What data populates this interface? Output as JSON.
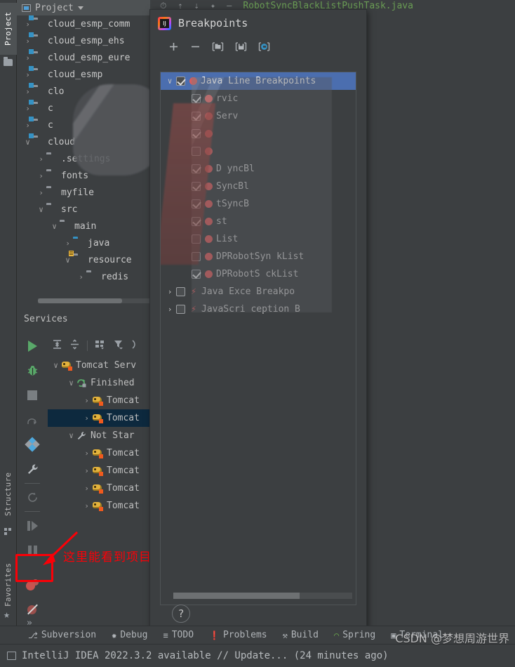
{
  "window": {
    "editor_tab": "RobotSyncBlackListPushTask.java"
  },
  "left_tool_tabs": [
    {
      "label": "Project",
      "icon": "folder-icon",
      "active": true
    },
    {
      "label": "Structure",
      "icon": "structure-icon",
      "active": false
    },
    {
      "label": "Favorites",
      "icon": "star-icon",
      "active": false
    }
  ],
  "project_panel": {
    "title": "Project",
    "icon": "project-icon",
    "dropdown_icon": "chevron-down-icon",
    "tree": [
      {
        "label": "cloud_esmp_comm",
        "indent": 0,
        "arrow": "›",
        "icon": "module-folder",
        "expanded": false
      },
      {
        "label": "cloud_esmp_ehs",
        "indent": 0,
        "arrow": "›",
        "icon": "module-folder",
        "expanded": false
      },
      {
        "label": "cloud_esmp_eure",
        "indent": 0,
        "arrow": "›",
        "icon": "module-folder",
        "expanded": false
      },
      {
        "label": "cloud_esmp",
        "indent": 0,
        "arrow": "›",
        "icon": "module-folder",
        "expanded": false
      },
      {
        "label": "clo",
        "indent": 0,
        "arrow": "›",
        "icon": "module-folder",
        "expanded": false
      },
      {
        "label": "c",
        "indent": 0,
        "arrow": "›",
        "icon": "module-folder",
        "expanded": false
      },
      {
        "label": "c",
        "indent": 0,
        "arrow": "›",
        "icon": "module-folder",
        "expanded": false
      },
      {
        "label": "cloud",
        "indent": 0,
        "arrow": "∨",
        "icon": "module-folder",
        "expanded": true
      },
      {
        "label": ".settings",
        "indent": 1,
        "arrow": "›",
        "icon": "plain-folder",
        "expanded": false
      },
      {
        "label": "fonts",
        "indent": 1,
        "arrow": "›",
        "icon": "plain-folder",
        "expanded": false
      },
      {
        "label": "myfile",
        "indent": 1,
        "arrow": "›",
        "icon": "plain-folder",
        "expanded": false
      },
      {
        "label": "src",
        "indent": 1,
        "arrow": "∨",
        "icon": "plain-folder",
        "expanded": true
      },
      {
        "label": "main",
        "indent": 2,
        "arrow": "∨",
        "icon": "plain-folder",
        "expanded": true
      },
      {
        "label": "java",
        "indent": 3,
        "arrow": "›",
        "icon": "source-folder",
        "expanded": false
      },
      {
        "label": "resource",
        "indent": 3,
        "arrow": "∨",
        "icon": "resource-folder",
        "expanded": true
      },
      {
        "label": "redis",
        "indent": 4,
        "arrow": "›",
        "icon": "plain-folder",
        "expanded": false
      }
    ]
  },
  "services_panel": {
    "title": "Services",
    "run_toolbar": [
      {
        "name": "run-button",
        "icon": "play-icon"
      },
      {
        "name": "debug-button",
        "icon": "bug-icon"
      },
      {
        "name": "stop-button",
        "icon": "stop-icon"
      },
      {
        "name": "step-over-button",
        "icon": "step-over-icon"
      },
      {
        "name": "layers-button",
        "icon": "diamond-icon"
      },
      {
        "name": "settings-button",
        "icon": "wrench-icon"
      },
      {
        "name": "rerun-button",
        "icon": "refresh-icon"
      },
      {
        "name": "step-into-button",
        "icon": "step-into-icon"
      },
      {
        "name": "pause-button",
        "icon": "pause-icon"
      },
      {
        "name": "view-breakpoints-button",
        "icon": "breakpoints-icon"
      },
      {
        "name": "mute-breakpoints-button",
        "icon": "mute-breakpoints-icon"
      }
    ],
    "view_toolbar": [
      {
        "name": "expand-all-button",
        "icon": "expand-all-icon"
      },
      {
        "name": "collapse-all-button",
        "icon": "collapse-all-icon"
      },
      {
        "name": "group-by-button",
        "icon": "group-by-icon"
      },
      {
        "name": "filter-button",
        "icon": "filter-icon"
      },
      {
        "name": "more-button",
        "icon": "more-icon"
      }
    ],
    "tree": [
      {
        "label": "Tomcat Serv",
        "indent": 0,
        "arrow": "∨",
        "icon": "tomcat-icon",
        "selected": false
      },
      {
        "label": "Finished",
        "indent": 1,
        "arrow": "∨",
        "icon": "finished-icon",
        "selected": false
      },
      {
        "label": "Tomcat",
        "indent": 2,
        "arrow": "›",
        "icon": "tomcat-icon",
        "selected": false
      },
      {
        "label": "Tomcat",
        "indent": 2,
        "arrow": "›",
        "icon": "tomcat-icon",
        "selected": true
      },
      {
        "label": "Not Star",
        "indent": 1,
        "arrow": "∨",
        "icon": "wrench-icon",
        "selected": false
      },
      {
        "label": "Tomcat",
        "indent": 2,
        "arrow": "›",
        "icon": "tomcat-icon",
        "selected": false
      },
      {
        "label": "Tomcat",
        "indent": 2,
        "arrow": "›",
        "icon": "tomcat-icon",
        "selected": false
      },
      {
        "label": "Tomcat",
        "indent": 2,
        "arrow": "›",
        "icon": "tomcat-icon",
        "selected": false
      },
      {
        "label": "Tomcat",
        "indent": 2,
        "arrow": "›",
        "icon": "tomcat-icon",
        "selected": false
      }
    ]
  },
  "annotation": {
    "text": "这里能看到项目中断点",
    "color": "#fb0007",
    "arrow_icon": "red-arrow-icon",
    "rect_target": "view-breakpoints-button"
  },
  "breakpoints_dialog": {
    "title": "Breakpoints",
    "app_icon": "intellij-idea-icon",
    "toolbar": [
      {
        "name": "add-breakpoint-button",
        "icon": "plus-icon",
        "glyph": "＋"
      },
      {
        "name": "remove-breakpoint-button",
        "icon": "minus-icon",
        "glyph": "−"
      },
      {
        "name": "open-group-button",
        "icon": "folder-icon",
        "glyph": "⬚"
      },
      {
        "name": "save-group-button",
        "icon": "save-icon",
        "glyph": "⬚"
      },
      {
        "name": "groups-button",
        "icon": "circle-c-icon",
        "glyph": "Ⓒ"
      }
    ],
    "rows": [
      {
        "label": "Java Line Breakpoints",
        "indent": 0,
        "arrow": "∨",
        "checkbox": "checked",
        "marker": "breakpoint-dot",
        "selected": true,
        "obscured": false
      },
      {
        "label": "rvic",
        "indent": 1,
        "arrow": "",
        "checkbox": "checked",
        "marker": "breakpoint-dot",
        "selected": false,
        "obscured": true
      },
      {
        "label": "Serv",
        "indent": 1,
        "arrow": "",
        "checkbox": "checked",
        "marker": "breakpoint-dot",
        "selected": false,
        "obscured": true
      },
      {
        "label": "",
        "indent": 1,
        "arrow": "",
        "checkbox": "checked",
        "marker": "breakpoint-dot",
        "selected": false,
        "obscured": true
      },
      {
        "label": "",
        "indent": 1,
        "arrow": "",
        "checkbox": "unchecked",
        "marker": "breakpoint-dot",
        "selected": false,
        "obscured": true
      },
      {
        "label": "D      yncBl",
        "indent": 1,
        "arrow": "",
        "checkbox": "checked",
        "marker": "breakpoint-dot",
        "selected": false,
        "obscured": true
      },
      {
        "label": "SyncBl",
        "indent": 1,
        "arrow": "",
        "checkbox": "checked",
        "marker": "breakpoint-dot",
        "selected": false,
        "obscured": true
      },
      {
        "label": "tSyncB",
        "indent": 1,
        "arrow": "",
        "checkbox": "checked",
        "marker": "breakpoint-dot",
        "selected": false,
        "obscured": true
      },
      {
        "label": "st",
        "indent": 1,
        "arrow": "",
        "checkbox": "checked",
        "marker": "breakpoint-dot",
        "selected": false,
        "obscured": true
      },
      {
        "label": "List",
        "indent": 1,
        "arrow": "",
        "checkbox": "unchecked",
        "marker": "breakpoint-dot",
        "selected": false,
        "obscured": true
      },
      {
        "label": "DPRobotSyn      kList",
        "indent": 1,
        "arrow": "",
        "checkbox": "unchecked",
        "marker": "breakpoint-dot",
        "selected": false,
        "obscured": true
      },
      {
        "label": "DPRobotS      ckList",
        "indent": 1,
        "arrow": "",
        "checkbox": "checked",
        "marker": "breakpoint-dot",
        "selected": false,
        "obscured": true
      },
      {
        "label": "Java Exce     Breakpo",
        "indent": 0,
        "arrow": "›",
        "checkbox": "unchecked",
        "marker": "exception-bolt",
        "selected": false,
        "obscured": true
      },
      {
        "label": "JavaScri   ception B",
        "indent": 0,
        "arrow": "›",
        "checkbox": "unchecked",
        "marker": "exception-bolt",
        "selected": false,
        "obscured": true
      }
    ],
    "help_button_glyph": "?",
    "scrollbar": "horizontal-scrollbar"
  },
  "bottom_tool_bar": [
    {
      "label": "Subversion",
      "icon": "branch-icon",
      "glyph": "⎇"
    },
    {
      "label": "Debug",
      "icon": "bug-icon",
      "glyph": "✹"
    },
    {
      "label": "TODO",
      "icon": "list-icon",
      "glyph": "≡"
    },
    {
      "label": "Problems",
      "icon": "warning-icon",
      "glyph": "❗"
    },
    {
      "label": "Build",
      "icon": "hammer-icon",
      "glyph": "⚒"
    },
    {
      "label": "Spring",
      "icon": "spring-leaf-icon",
      "glyph": "◠"
    },
    {
      "label": "Terminal",
      "icon": "terminal-icon",
      "glyph": "▣"
    }
  ],
  "status_bar": {
    "icon": "ide-update-icon",
    "text": "IntelliJ IDEA 2022.3.2 available  //  Update...  (24 minutes ago)"
  },
  "watermark": "CSDN @梦想周游世界",
  "colors": {
    "background": "#3c3f41",
    "panel_header": "#4e5254",
    "selection_blue": "#4b6eaf",
    "selection_navy": "#0d293e",
    "text": "#a9b7c6",
    "breakpoint_red": "#db5c5c",
    "annotation_red": "#fb0007",
    "source_blue": "#3592c4",
    "run_green": "#59a869",
    "tab_green": "#6a9d54"
  }
}
